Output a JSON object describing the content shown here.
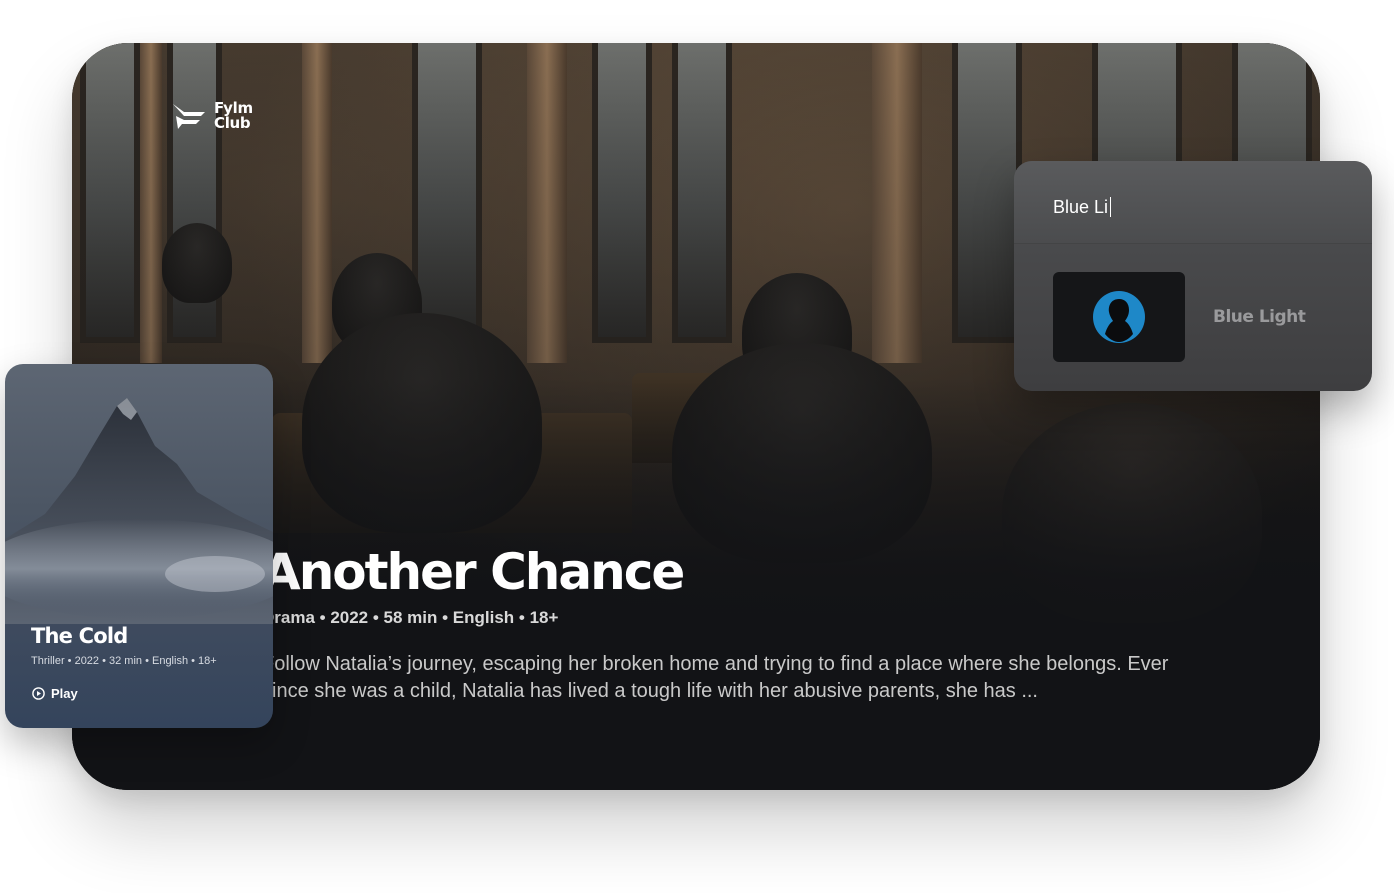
{
  "brand": {
    "line1": "Fylm",
    "line2": "Club"
  },
  "hero": {
    "title": "Another Chance",
    "meta": "Drama • 2022 • 58 min • English • 18+",
    "description": "Follow Natalia’s journey, escaping her broken home and trying to find a place where she belongs. Ever since she was a child, Natalia has lived a tough life with her abusive parents, she has ..."
  },
  "search": {
    "query": "Blue Li",
    "result_label": "Blue Light",
    "result_icon": "person-silhouette-icon",
    "accent": "#1e88c8"
  },
  "poster": {
    "title": "The Cold",
    "meta": "Thriller • 2022 • 32 min • English • 18+",
    "play_label": "Play",
    "play_icon": "play-circle-icon"
  }
}
